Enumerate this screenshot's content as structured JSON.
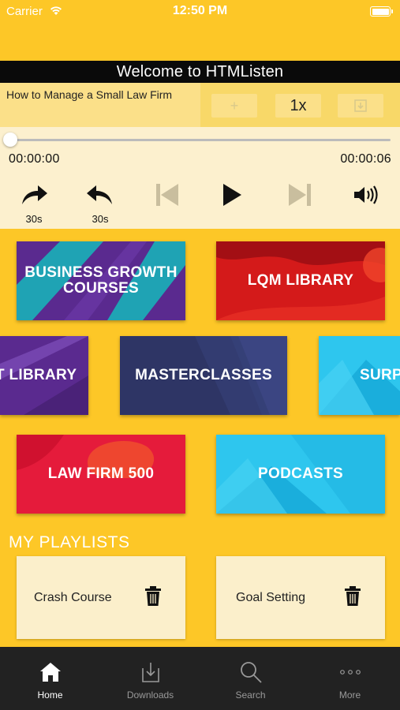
{
  "status_bar": {
    "carrier": "Carrier",
    "time": "12:50 PM"
  },
  "welcome": "Welcome to HTMListen",
  "now_playing": {
    "title": "How to Manage a Small Law Firm",
    "add_label": "+",
    "speed_label": "1x"
  },
  "player": {
    "current_time": "00:00:00",
    "total_time": "00:00:06",
    "progress": 0,
    "forward_label": "30s",
    "rewind_label": "30s"
  },
  "categories": [
    {
      "label": "BUSINESS GROWTH COURSES"
    },
    {
      "label": "LQM LIBRARY"
    },
    {
      "label": "T LIBRARY"
    },
    {
      "label": "MASTERCLASSES"
    },
    {
      "label": "SURP"
    },
    {
      "label": "LAW FIRM 500"
    },
    {
      "label": "PODCASTS"
    }
  ],
  "playlists": {
    "heading": "MY PLAYLISTS",
    "items": [
      {
        "name": "Crash Course"
      },
      {
        "name": "Goal Setting"
      }
    ]
  },
  "tabs": [
    {
      "label": "Home",
      "icon": "home-icon",
      "active": true
    },
    {
      "label": "Downloads",
      "icon": "download-icon"
    },
    {
      "label": "Search",
      "icon": "search-icon"
    },
    {
      "label": "More",
      "icon": "more-icon"
    }
  ],
  "colors": {
    "background": "#FDC727",
    "welcome_bar": "#0a0a0a",
    "player_bg": "#FCF0CE",
    "tabbar": "#222222"
  }
}
